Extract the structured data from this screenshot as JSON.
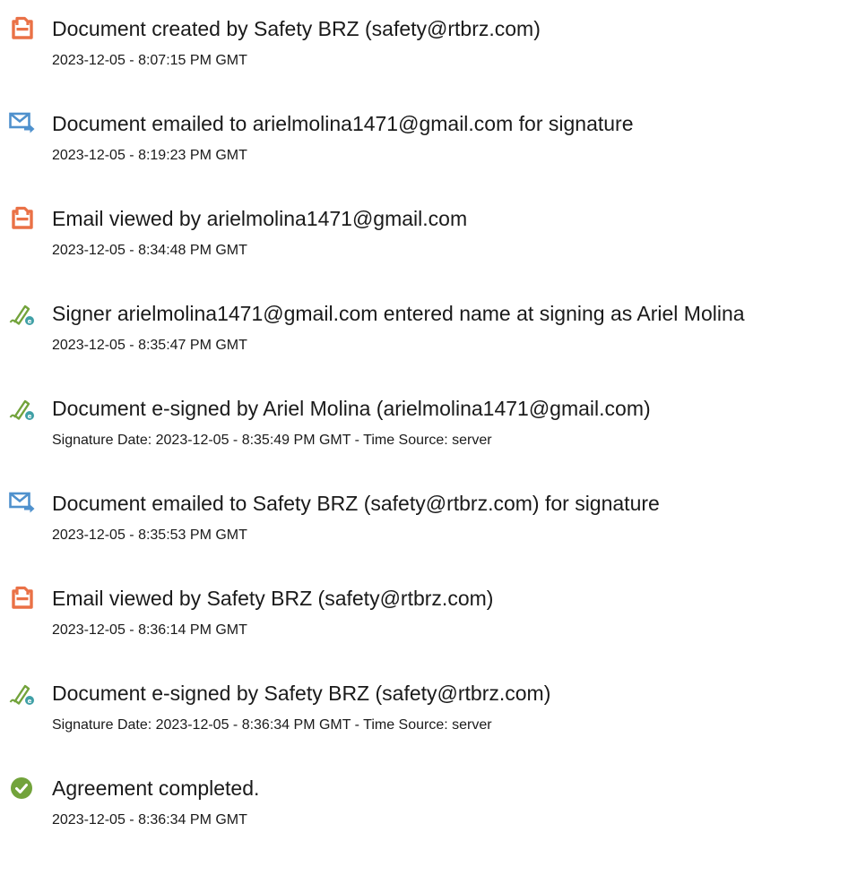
{
  "colors": {
    "document_icon": "#ea7146",
    "email_icon": "#4f91cd",
    "signature_icon": "#72a33b",
    "signature_badge": "#40a0a6",
    "completed_icon": "#72a33b",
    "text": "#1a1a1a"
  },
  "events": [
    {
      "icon": "document-icon",
      "title": "Document created by Safety BRZ (safety@rtbrz.com)",
      "time": "2023-12-05 - 8:07:15 PM GMT"
    },
    {
      "icon": "email-icon",
      "title": "Document emailed to arielmolina1471@gmail.com for signature",
      "time": "2023-12-05 - 8:19:23 PM GMT"
    },
    {
      "icon": "document-icon",
      "title": "Email viewed by arielmolina1471@gmail.com",
      "time": "2023-12-05 - 8:34:48 PM GMT"
    },
    {
      "icon": "signature-icon",
      "title": "Signer arielmolina1471@gmail.com entered name at signing as Ariel Molina",
      "time": "2023-12-05 - 8:35:47 PM GMT"
    },
    {
      "icon": "signature-icon",
      "title": "Document e-signed by Ariel Molina (arielmolina1471@gmail.com)",
      "time": "Signature Date: 2023-12-05 - 8:35:49 PM GMT - Time Source: server"
    },
    {
      "icon": "email-icon",
      "title": "Document emailed to Safety BRZ (safety@rtbrz.com) for signature",
      "time": "2023-12-05 - 8:35:53 PM GMT"
    },
    {
      "icon": "document-icon",
      "title": "Email viewed by Safety BRZ (safety@rtbrz.com)",
      "time": "2023-12-05 - 8:36:14 PM GMT"
    },
    {
      "icon": "signature-icon",
      "title": "Document e-signed by Safety BRZ (safety@rtbrz.com)",
      "time": "Signature Date: 2023-12-05 - 8:36:34 PM GMT - Time Source: server"
    },
    {
      "icon": "check-circle-icon",
      "title": "Agreement completed.",
      "time": "2023-12-05 - 8:36:34 PM GMT"
    }
  ]
}
